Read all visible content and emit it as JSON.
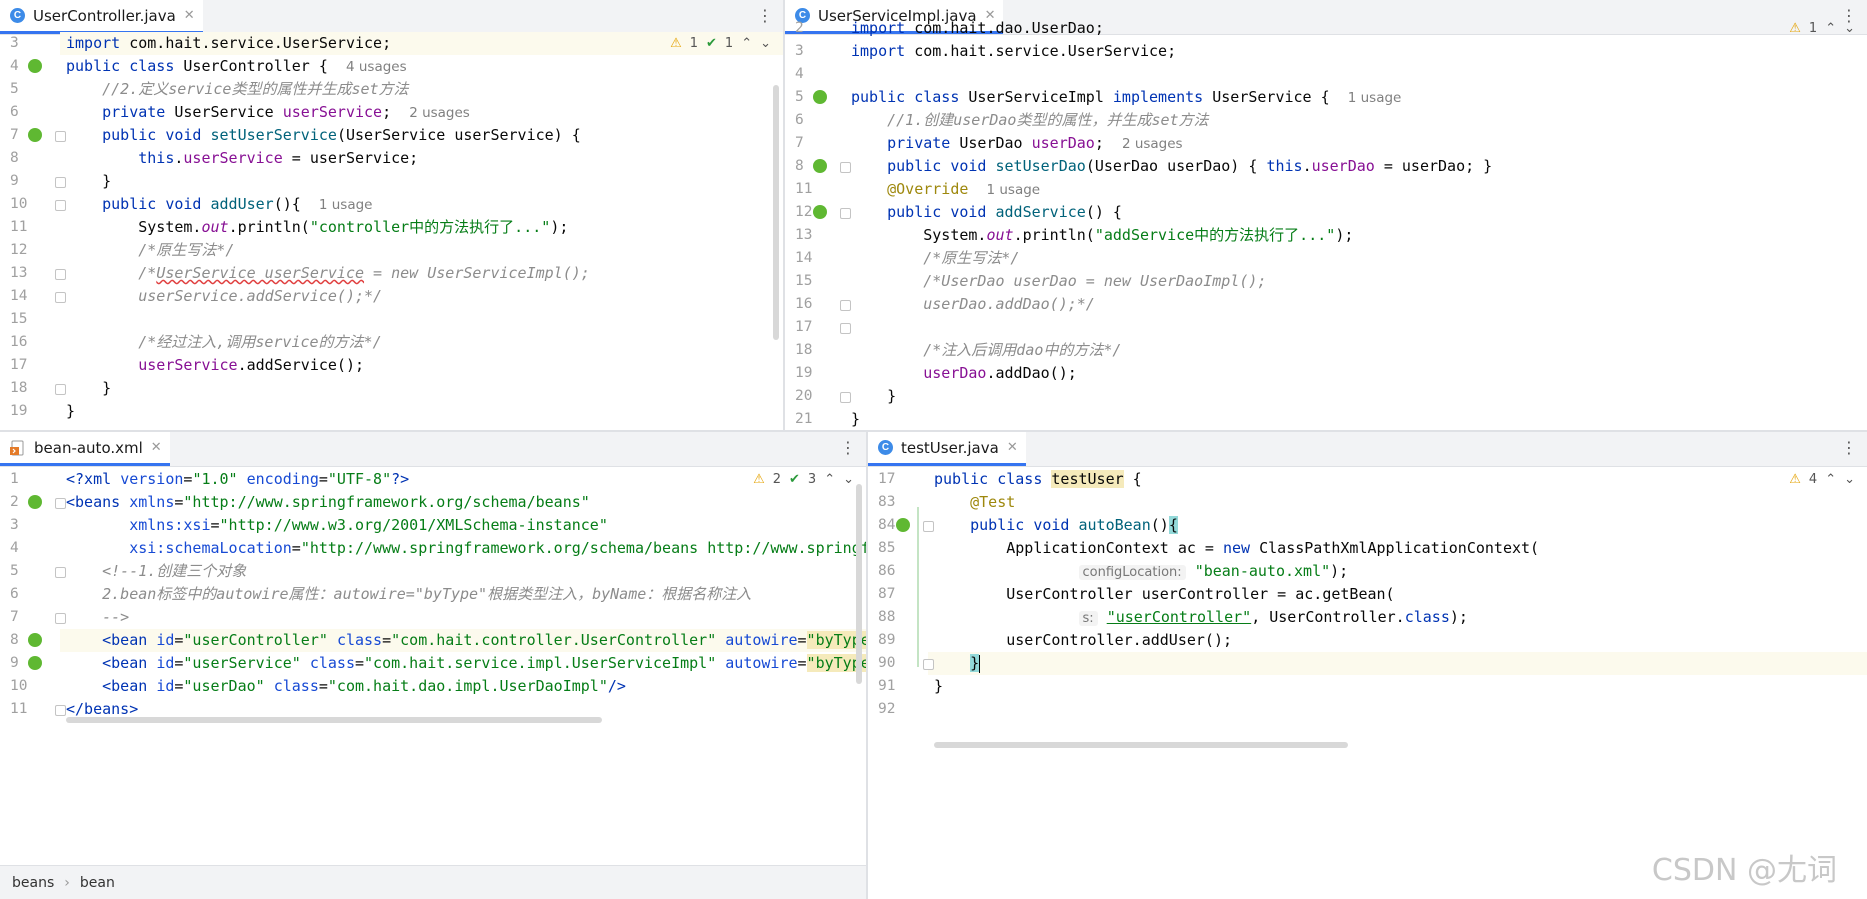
{
  "panes": {
    "top_left": {
      "tab": {
        "title": "UserController.java",
        "icon": "class-icon"
      },
      "inspections": {
        "warnings": "1",
        "typos": "1"
      },
      "lines": [
        {
          "n": "3",
          "html": "<span class=\"kw\">import</span> com.hait.service.UserService;"
        },
        {
          "n": "4",
          "html": "<span class=\"kw\">public class</span> UserController {  <span class=\"hint\">4 usages</span>"
        },
        {
          "n": "5",
          "html": "    <span class=\"cmt\">//2.定义service类型的属性并生成set方法</span>"
        },
        {
          "n": "6",
          "html": "    <span class=\"kw\">private</span> UserService <span class=\"fld\">userService</span>;  <span class=\"hint\">2 usages</span>"
        },
        {
          "n": "7",
          "html": "    <span class=\"kw\">public void</span> <span class=\"met\">setUserService</span>(UserService userService) {"
        },
        {
          "n": "8",
          "html": "        <span class=\"kw\">this</span>.<span class=\"fld\">userService</span> = userService;"
        },
        {
          "n": "9",
          "html": "    }"
        },
        {
          "n": "10",
          "html": "    <span class=\"kw\">public void</span> <span class=\"met\">addUser</span>(){  <span class=\"hint\">1 usage</span>"
        },
        {
          "n": "11",
          "html": "        System.<span class=\"st\">out</span>.println(<span class=\"str\">\"controller中的方法执行了...\"</span>);"
        },
        {
          "n": "12",
          "html": "        <span class=\"cmt\">/*原生写法*/</span>"
        },
        {
          "n": "13",
          "html": "        <span class=\"cmt\">/*<span class=\"under\">UserService userService</span> = new UserServiceImpl();</span>"
        },
        {
          "n": "14",
          "html": "        <span class=\"cmt\">userService.addService();*/</span>"
        },
        {
          "n": "15",
          "html": ""
        },
        {
          "n": "16",
          "html": "        <span class=\"cmt\">/*经过注入,调用service的方法*/</span>"
        },
        {
          "n": "17",
          "html": "        <span class=\"fld\">userService</span>.addService();"
        },
        {
          "n": "18",
          "html": "    }"
        },
        {
          "n": "19",
          "html": "}"
        }
      ]
    },
    "top_right": {
      "tab": {
        "title": "UserServiceImpl.java",
        "icon": "class-icon"
      },
      "inspections": {
        "warnings": "1"
      },
      "lines": [
        {
          "n": "2",
          "html": "<span class=\"kw\">import</span> com.hait.dao.UserDao;"
        },
        {
          "n": "3",
          "html": "<span class=\"kw\">import</span> com.hait.service.UserService;"
        },
        {
          "n": "4",
          "html": ""
        },
        {
          "n": "5",
          "html": "<span class=\"kw\">public class</span> UserServiceImpl <span class=\"kw\">implements</span> UserService {  <span class=\"hint\">1 usage</span>"
        },
        {
          "n": "6",
          "html": "    <span class=\"cmt\">//1.创建userDao类型的属性，并生成set方法</span>"
        },
        {
          "n": "7",
          "html": "    <span class=\"kw\">private</span> UserDao <span class=\"fld\">userDao</span>;  <span class=\"hint\">2 usages</span>"
        },
        {
          "n": "8",
          "html": "    <span class=\"kw\">public void</span> <span class=\"met\">setUserDao</span>(UserDao userDao) { <span class=\"kw\">this</span>.<span class=\"fld\">userDao</span> = userDao; }"
        },
        {
          "n": "11",
          "html": "    <span class=\"ann\">@Override</span>  <span class=\"hint\">1 usage</span>"
        },
        {
          "n": "12",
          "html": "    <span class=\"kw\">public void</span> <span class=\"met\">addService</span>() {"
        },
        {
          "n": "13",
          "html": "        System.<span class=\"st\">out</span>.println(<span class=\"str\">\"addService中的方法执行了...\"</span>);"
        },
        {
          "n": "14",
          "html": "        <span class=\"cmt\">/*原生写法*/</span>"
        },
        {
          "n": "15",
          "html": "        <span class=\"cmt\">/*UserDao userDao = new UserDaoImpl();</span>"
        },
        {
          "n": "16",
          "html": "        <span class=\"cmt\">userDao.addDao();*/</span>"
        },
        {
          "n": "17",
          "html": ""
        },
        {
          "n": "18",
          "html": "        <span class=\"cmt\">/*注入后调用dao中的方法*/</span>"
        },
        {
          "n": "19",
          "html": "        <span class=\"fld\">userDao</span>.addDao();"
        },
        {
          "n": "20",
          "html": "    }"
        },
        {
          "n": "21",
          "html": "}"
        }
      ]
    },
    "bottom_left": {
      "tab": {
        "title": "bean-auto.xml",
        "icon": "xml-icon"
      },
      "inspections": {
        "warnings": "2",
        "ok": "3"
      },
      "lines": [
        {
          "n": "1",
          "html": "<span class=\"xtag\">&lt;?xml</span> <span class=\"xattr\">version</span>=<span class=\"xval\">\"1.0\"</span> <span class=\"xattr\">encoding</span>=<span class=\"xval\">\"UTF-8\"</span><span class=\"xtag\">?&gt;</span>"
        },
        {
          "n": "2",
          "html": "<span class=\"xtag\">&lt;beans</span> <span class=\"xattr\">xmlns</span>=<span class=\"xval\">\"http://www.springframework.org/schema/beans\"</span>"
        },
        {
          "n": "3",
          "html": "       <span class=\"xattr\">xmlns:xsi</span>=<span class=\"xval\">\"http://www.w3.org/2001/XMLSchema-instance\"</span>"
        },
        {
          "n": "4",
          "html": "       <span class=\"xattr\">xsi:schemaLocation</span>=<span class=\"xval\">\"http://www.springframework.org/schema/beans http://www.springframewo</span>"
        },
        {
          "n": "5",
          "html": "    <span class=\"cmt\">&lt;!--1.创建三个对象</span>"
        },
        {
          "n": "6",
          "html": "    <span class=\"cmt\">2.bean标签中的autowire属性：autowire=\"byType\"根据类型注入，byName：根据名称注入</span>"
        },
        {
          "n": "7",
          "html": "    <span class=\"cmt\">--&gt;</span>"
        },
        {
          "n": "8",
          "html": "    <span class=\"xtag\">&lt;bean</span> <span class=\"xattr\">id</span>=<span class=\"xval\">\"userController\"</span> <span class=\"xattr\">class</span>=<span class=\"xval\">\"com.hait.controller.UserController\"</span> <span class=\"xattr\">autowire</span>=<span class=\"xval hl\">\"byType\"</span><span class=\"xtag\">/&gt;</span>"
        },
        {
          "n": "9",
          "html": "    <span class=\"xtag\">&lt;bean</span> <span class=\"xattr\">id</span>=<span class=\"xval\">\"userService\"</span> <span class=\"xattr\">class</span>=<span class=\"xval\">\"com.hait.service.impl.UserServiceImpl\"</span> <span class=\"xattr\">autowire</span>=<span class=\"xval hl\">\"byType\"</span><span class=\"xtag\">/&gt;</span>"
        },
        {
          "n": "10",
          "html": "    <span class=\"xtag\">&lt;bean</span> <span class=\"xattr\">id</span>=<span class=\"xval\">\"userDao\"</span> <span class=\"xattr\">class</span>=<span class=\"xval\">\"com.hait.dao.impl.UserDaoImpl\"</span><span class=\"xtag\">/&gt;</span>"
        },
        {
          "n": "11",
          "html": "<span class=\"xtag\">&lt;/beans&gt;</span>"
        }
      ],
      "breadcrumb": [
        "beans",
        "bean"
      ]
    },
    "bottom_right": {
      "tab": {
        "title": "testUser.java",
        "icon": "test-class-icon"
      },
      "inspections": {
        "warnings": "4"
      },
      "lines": [
        {
          "n": "17",
          "html": "<span class=\"kw\">public class</span> <span class=\"hl\">testUser</span> {"
        },
        {
          "n": "83",
          "html": "    <span class=\"ann\">@Test</span>"
        },
        {
          "n": "84",
          "html": "    <span class=\"kw\">public void</span> <span class=\"met\">autoBean</span>()<span class=\"bracehl\">{</span>"
        },
        {
          "n": "85",
          "html": "        ApplicationContext ac = <span class=\"kw\">new</span> ClassPathXmlApplicationContext("
        },
        {
          "n": "86",
          "html": "                <span class=\"hintbox\">configLocation:</span> <span class=\"str\">\"bean-auto.xml\"</span>);"
        },
        {
          "n": "87",
          "html": "        UserController userController = ac.getBean("
        },
        {
          "n": "88",
          "html": "                <span class=\"hintbox\">s:</span> <span class=\"str ulink\">\"userController\"</span>, UserController.<span class=\"kw\">class</span>);"
        },
        {
          "n": "89",
          "html": "        userController.addUser();"
        },
        {
          "n": "90",
          "html": "    <span class=\"bracehl\">}</span><span class=\"caret\"></span>"
        },
        {
          "n": "91",
          "html": "}"
        },
        {
          "n": "92",
          "html": ""
        }
      ]
    }
  },
  "watermark": "CSDN @尢词"
}
